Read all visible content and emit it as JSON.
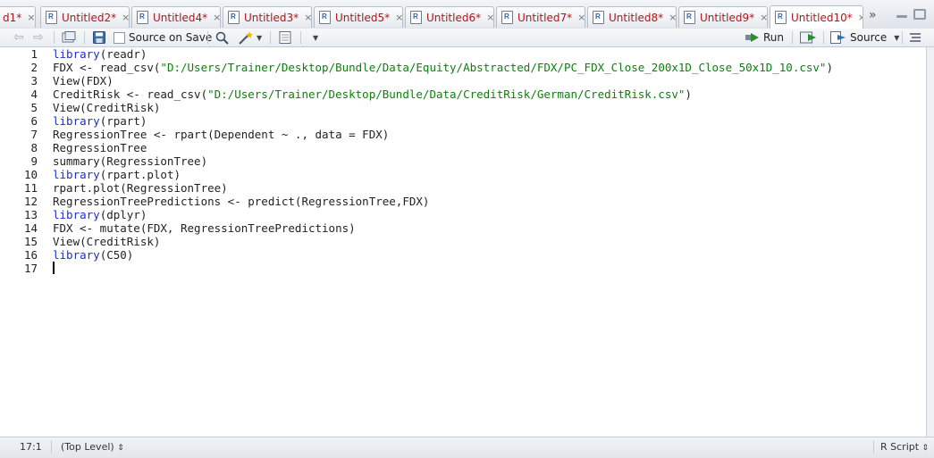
{
  "tabs": [
    {
      "label": "d1*"
    },
    {
      "label": "Untitled2*"
    },
    {
      "label": "Untitled4*"
    },
    {
      "label": "Untitled3*"
    },
    {
      "label": "Untitled5*"
    },
    {
      "label": "Untitled6*"
    },
    {
      "label": "Untitled7*"
    },
    {
      "label": "Untitled8*"
    },
    {
      "label": "Untitled9*"
    },
    {
      "label": "Untitled10*",
      "active": true
    }
  ],
  "tab_overflow_glyph": "»",
  "toolbar": {
    "source_on_save_label": "Source on Save",
    "source_on_save_checked": false,
    "run_label": "Run",
    "source_label": "Source"
  },
  "editor": {
    "line_numbers": [
      "1",
      "2",
      "3",
      "4",
      "5",
      "6",
      "7",
      "8",
      "9",
      "10",
      "11",
      "12",
      "13",
      "14",
      "15",
      "16",
      "17"
    ],
    "lines": [
      [
        {
          "t": "library",
          "c": "keyword"
        },
        {
          "t": "(readr)",
          "c": "op"
        }
      ],
      [
        {
          "t": "FDX <- read_csv(",
          "c": "op"
        },
        {
          "t": "\"D:/Users/Trainer/Desktop/Bundle/Data/Equity/Abstracted/FDX/PC_FDX_Close_200x1D_Close_50x1D_10.csv\"",
          "c": "string"
        },
        {
          "t": ")",
          "c": "op"
        }
      ],
      [
        {
          "t": "View(FDX)",
          "c": "op"
        }
      ],
      [
        {
          "t": "CreditRisk <- read_csv(",
          "c": "op"
        },
        {
          "t": "\"D:/Users/Trainer/Desktop/Bundle/Data/CreditRisk/German/CreditRisk.csv\"",
          "c": "string"
        },
        {
          "t": ")",
          "c": "op"
        }
      ],
      [
        {
          "t": "View(CreditRisk)",
          "c": "op"
        }
      ],
      [
        {
          "t": "library",
          "c": "keyword"
        },
        {
          "t": "(rpart)",
          "c": "op"
        }
      ],
      [
        {
          "t": "RegressionTree <- rpart(Dependent ~ ., data = FDX)",
          "c": "op"
        }
      ],
      [
        {
          "t": "RegressionTree",
          "c": "op"
        }
      ],
      [
        {
          "t": "summary(RegressionTree)",
          "c": "op"
        }
      ],
      [
        {
          "t": "library",
          "c": "keyword"
        },
        {
          "t": "(rpart.plot)",
          "c": "op"
        }
      ],
      [
        {
          "t": "rpart.plot(RegressionTree)",
          "c": "op"
        }
      ],
      [
        {
          "t": "RegressionTreePredictions <- predict(RegressionTree,FDX)",
          "c": "op"
        }
      ],
      [
        {
          "t": "library",
          "c": "keyword"
        },
        {
          "t": "(dplyr)",
          "c": "op"
        }
      ],
      [
        {
          "t": "FDX <- mutate(FDX, RegressionTreePredictions)",
          "c": "op"
        }
      ],
      [
        {
          "t": "View(CreditRisk)",
          "c": "op"
        }
      ],
      [
        {
          "t": "library",
          "c": "keyword"
        },
        {
          "t": "(C50)",
          "c": "op"
        }
      ],
      []
    ]
  },
  "status": {
    "position": "17:1",
    "scope": "(Top Level)",
    "file_type": "R Script"
  }
}
